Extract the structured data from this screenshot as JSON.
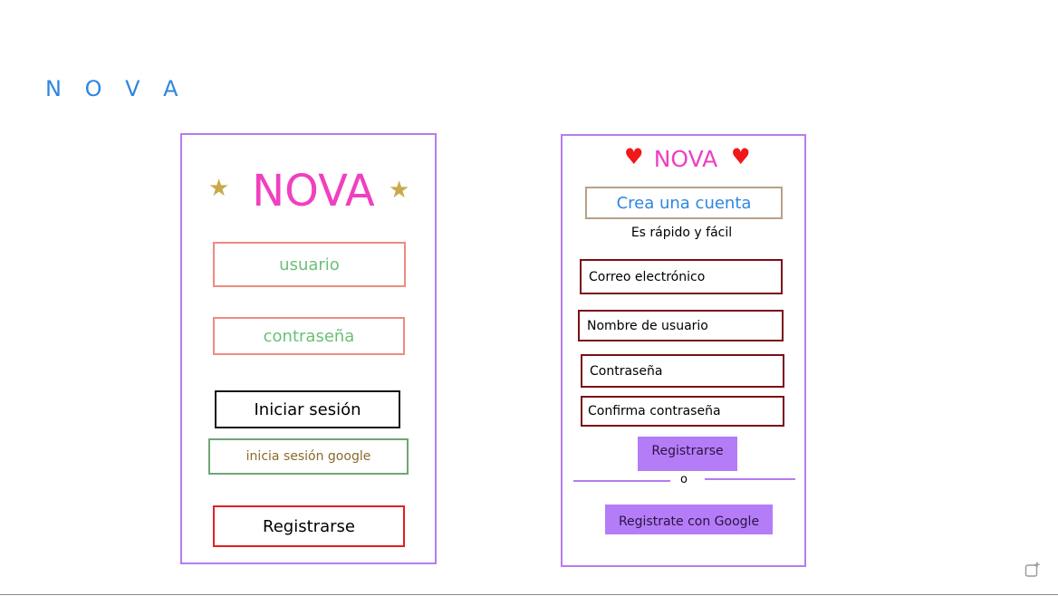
{
  "brand": "N O V A",
  "login": {
    "title": "NOVA",
    "username_label": "usuario",
    "password_label": "contraseña",
    "login_button": "Iniciar sesión",
    "google_button": "inicia sesión google",
    "register_button": "Registrarse"
  },
  "signup": {
    "title": "NOVA",
    "heading": "Crea una cuenta",
    "subtitle": "Es rápido y fácil",
    "email_label": "Correo electrónico",
    "username_label": "Nombre de usuario",
    "password_label": "Contraseña",
    "confirm_label": "Confirma contraseña",
    "register_button": "Registrarse",
    "divider_text": "o",
    "google_button": "Registrate con Google"
  },
  "icons": {
    "star": "star-icon",
    "heart": "heart-icon",
    "corner": "add-comment-icon"
  },
  "colors": {
    "brand_blue": "#2f86e0",
    "title_pink": "#f040c0",
    "frame_purple": "#b57cf0",
    "button_purple": "#b57cf8",
    "field_coral": "#f08a80",
    "field_green_text": "#6cbf78",
    "field_darkred": "#7a0f16",
    "register_red": "#e02020",
    "star_gold": "#c9a94a"
  }
}
